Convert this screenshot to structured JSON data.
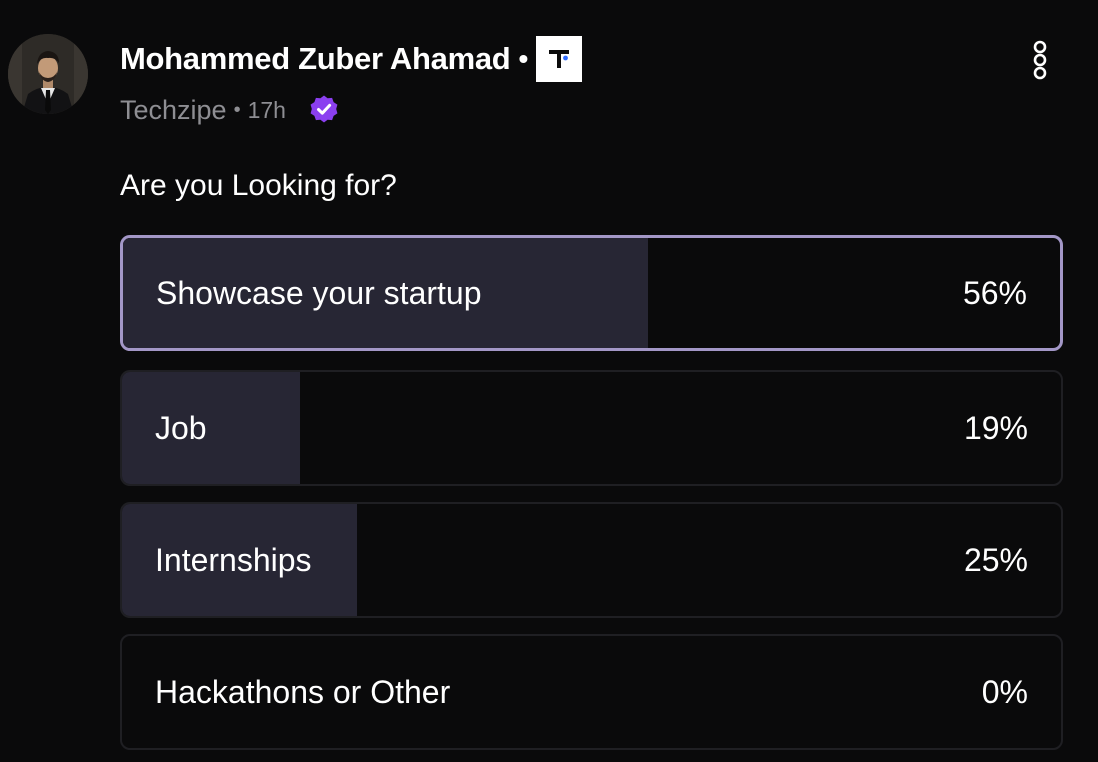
{
  "post": {
    "author_name": "Mohammed Zuber Ahamad",
    "author_separator": "•",
    "brand_logo_icon": "techzipe-logo-icon",
    "company": "Techzipe",
    "meta_separator": "•",
    "time_ago": "17h",
    "verified_icon": "verified-badge-icon",
    "more_icon": "more-vertical-icon"
  },
  "poll": {
    "question": "Are you Looking for?",
    "options": [
      {
        "label": "Showcase your startup",
        "percent_label": "56%",
        "share": 0.56,
        "selected": true
      },
      {
        "label": "Job",
        "percent_label": "19%",
        "share": 0.19,
        "selected": false
      },
      {
        "label": "Internships",
        "percent_label": "25%",
        "share": 0.25,
        "selected": false
      },
      {
        "label": "Hackathons or Other",
        "percent_label": "0%",
        "share": 0.0,
        "selected": false
      }
    ]
  },
  "colors": {
    "background": "#0a0a0b",
    "fill": "#272634",
    "selected_border": "#a397c7",
    "verified": "#8b3ff0",
    "muted_text": "#8e8e93"
  }
}
